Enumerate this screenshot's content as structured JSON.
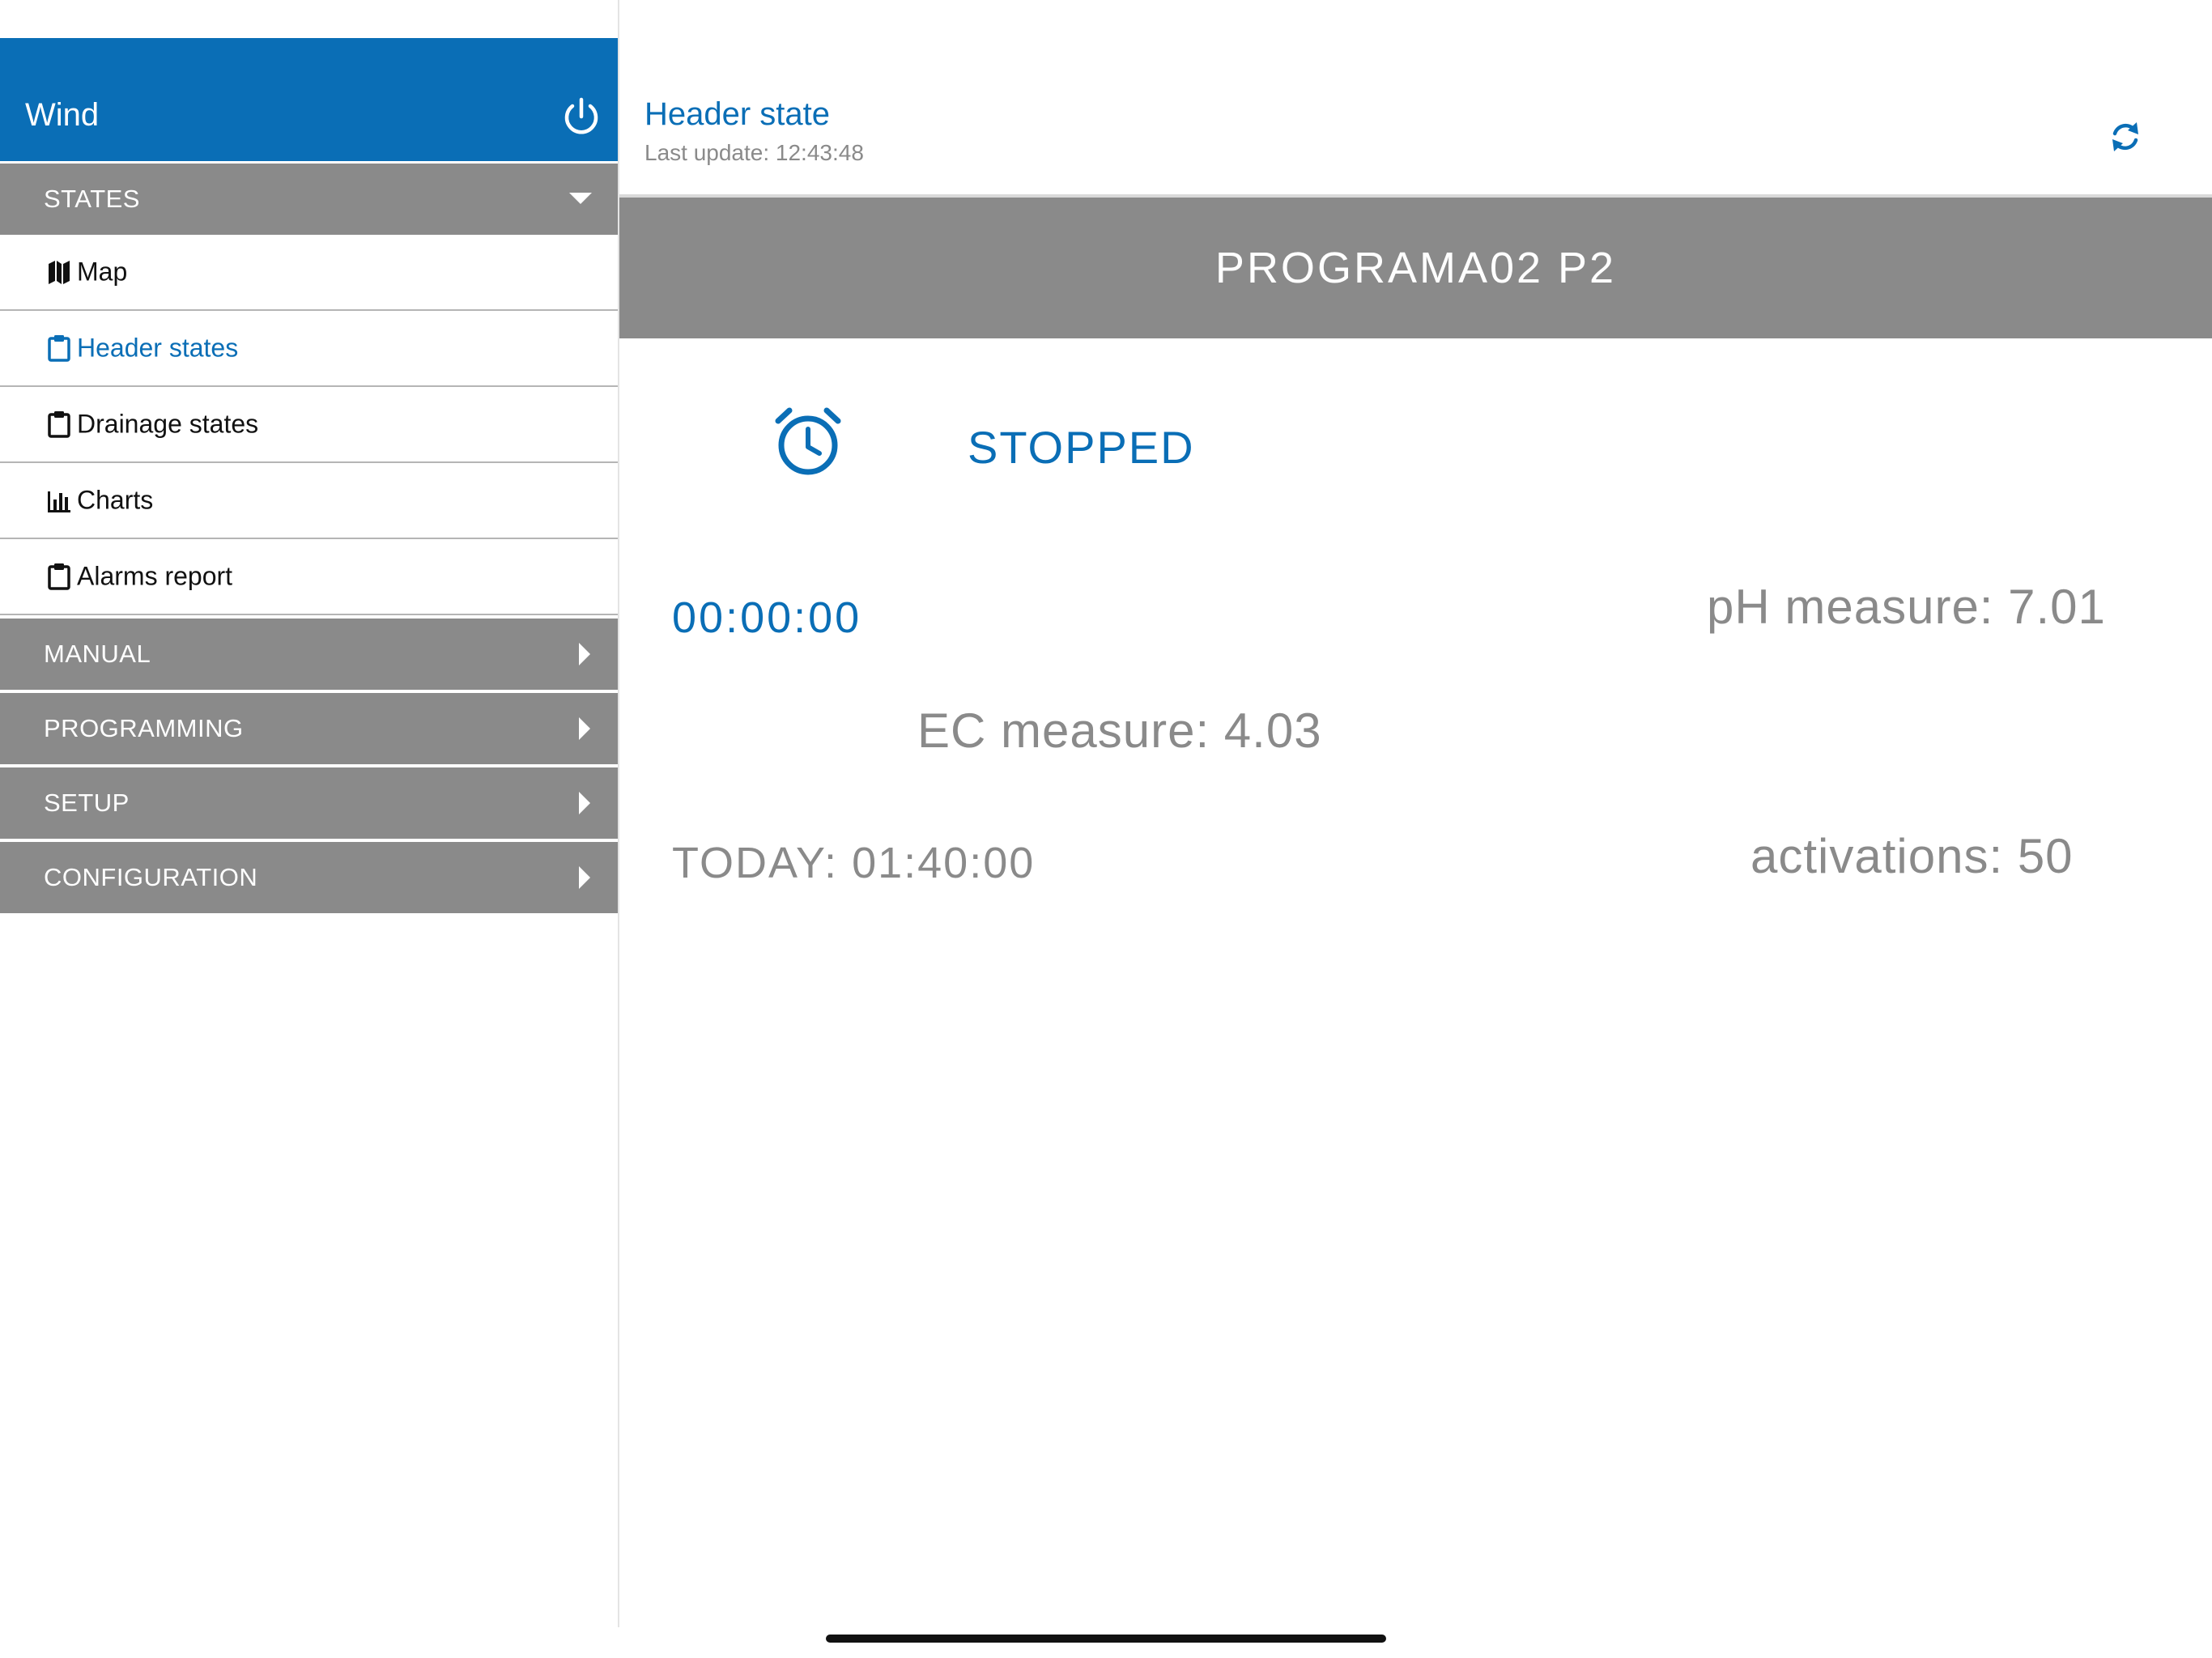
{
  "colors": {
    "accent": "#0a6eb6",
    "section_gray": "#8a8a8a",
    "text_gray": "#8a8a8a"
  },
  "sidebar": {
    "title": "Wind",
    "power_icon": "power-icon",
    "sections": {
      "states": {
        "label": "STATES",
        "expanded": true
      },
      "manual": {
        "label": "MANUAL"
      },
      "programming": {
        "label": "PROGRAMMING"
      },
      "setup": {
        "label": "SETUP"
      },
      "configuration": {
        "label": "CONFIGURATION"
      }
    },
    "items": [
      {
        "label": "Map",
        "icon": "map-icon"
      },
      {
        "label": "Header states",
        "icon": "clipboard-icon",
        "active": true
      },
      {
        "label": "Drainage states",
        "icon": "clipboard-icon"
      },
      {
        "label": "Charts",
        "icon": "bar-chart-icon"
      },
      {
        "label": "Alarms report",
        "icon": "clipboard-icon"
      }
    ]
  },
  "header": {
    "title": "Header state",
    "last_update": "Last update: 12:43:48",
    "refresh_icon": "refresh-icon"
  },
  "program": {
    "name": "PROGRAMA02 P2",
    "status": "STOPPED",
    "status_icon": "alarm-clock-icon",
    "timer": "00:00:00",
    "ph": "pH measure: 7.01",
    "ec": "EC measure: 4.03",
    "today": "TODAY: 01:40:00",
    "activations": "activations: 50"
  }
}
